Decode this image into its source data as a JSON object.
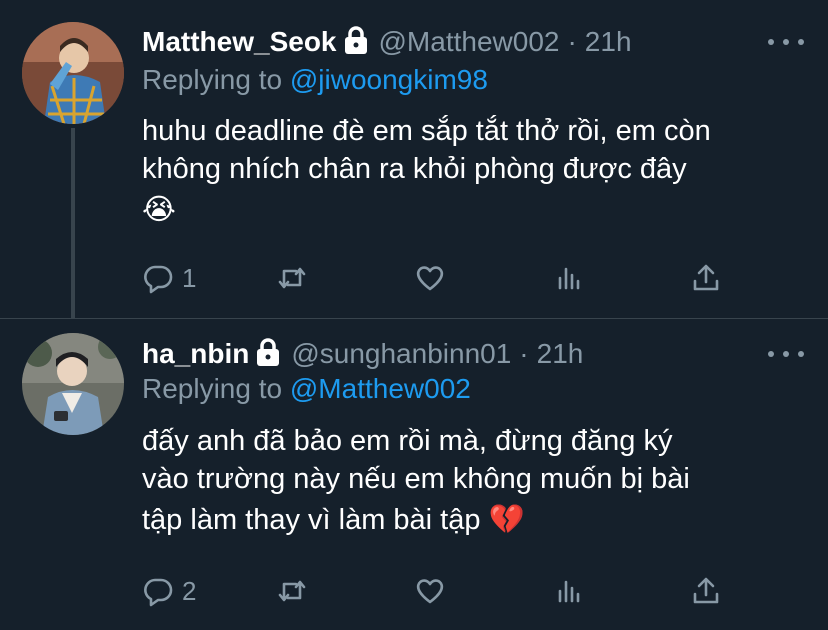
{
  "tweets": [
    {
      "name": "Matthew_Seok",
      "handle": "@Matthew002",
      "dot": "·",
      "time": "21h",
      "replying_prefix": "Replying to ",
      "replying_to": "@jiwoongkim98",
      "text_line1": "huhu deadline đè em sắp tắt thở rồi, em còn",
      "text_line2": "không nhích chân ra khỏi phòng được đây",
      "emoji": "😭",
      "reply_count": "1",
      "avatar_colors": [
        "#9a6b52",
        "#3e7ab5",
        "#d9a42f"
      ]
    },
    {
      "name": "ha_nbin",
      "handle": "@sunghanbinn01",
      "dot": "·",
      "time": "21h",
      "replying_prefix": "Replying to ",
      "replying_to": "@Matthew002",
      "text_line1": "đấy anh đã bảo em rồi mà, đừng đăng ký",
      "text_line2": "vào trường này nếu em không muốn bị bài",
      "text_line3": "tập làm thay vì làm bài tập",
      "emoji": "💔",
      "reply_count": "2",
      "avatar_colors": [
        "#5a5f55",
        "#7d9bb8",
        "#2c2f33"
      ]
    }
  ],
  "colors": {
    "background": "#15202b",
    "text": "#ffffff",
    "muted": "#8899a6",
    "link": "#1d9bf0",
    "divider": "#38444d"
  },
  "icons": [
    "lock-icon",
    "more-icon",
    "reply-icon",
    "retweet-icon",
    "like-icon",
    "stats-icon",
    "share-icon"
  ]
}
